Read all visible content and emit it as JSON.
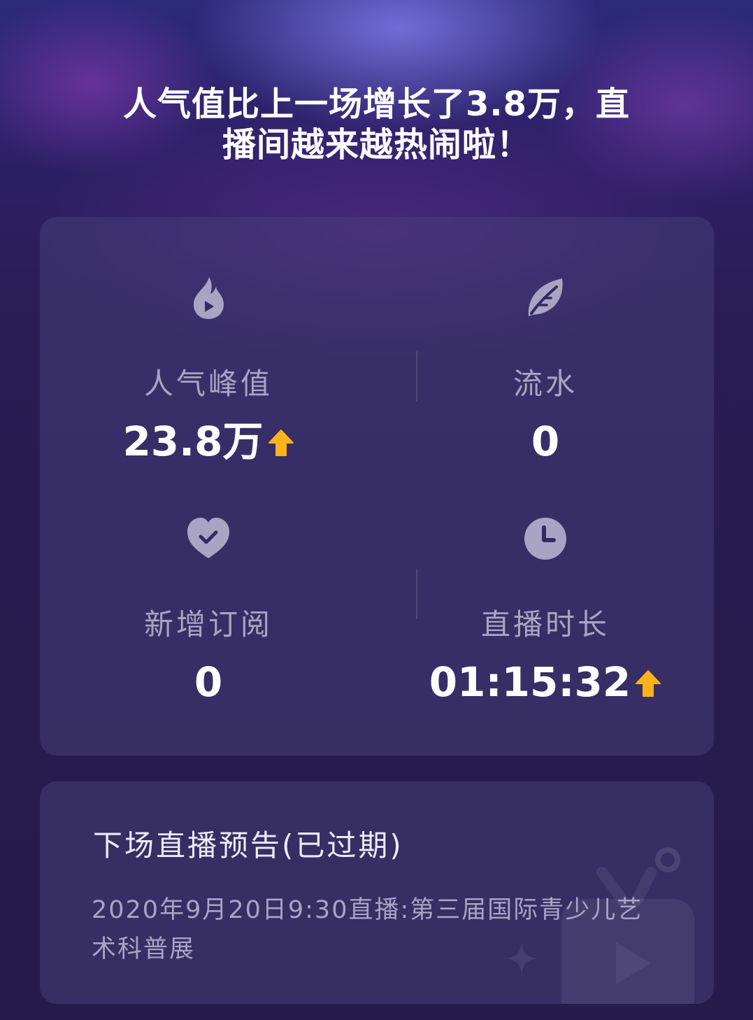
{
  "headline": {
    "line1": "人气值比上一场增长了3.8万，直",
    "line2": "播间越来越热闹啦！"
  },
  "stats": {
    "popularity_peak": {
      "label": "人气峰值",
      "value": "23.8万",
      "trend": "up",
      "icon": "flame-play-icon"
    },
    "revenue": {
      "label": "流水",
      "value": "0",
      "icon": "leaf-icon"
    },
    "new_subscriptions": {
      "label": "新增订阅",
      "value": "0",
      "icon": "heart-check-icon"
    },
    "live_duration": {
      "label": "直播时长",
      "value": "01:15:32",
      "trend": "up",
      "icon": "clock-icon"
    }
  },
  "next_live": {
    "title": "下场直播预告(已过期)",
    "description": "2020年9月20日9:30直播:第三届国际青少儿艺术科普展"
  },
  "colors": {
    "icon": "#a9a4c4",
    "trend_up": "#ffb21a",
    "text_primary": "#ffffff",
    "text_secondary": "#a9a4c4"
  }
}
